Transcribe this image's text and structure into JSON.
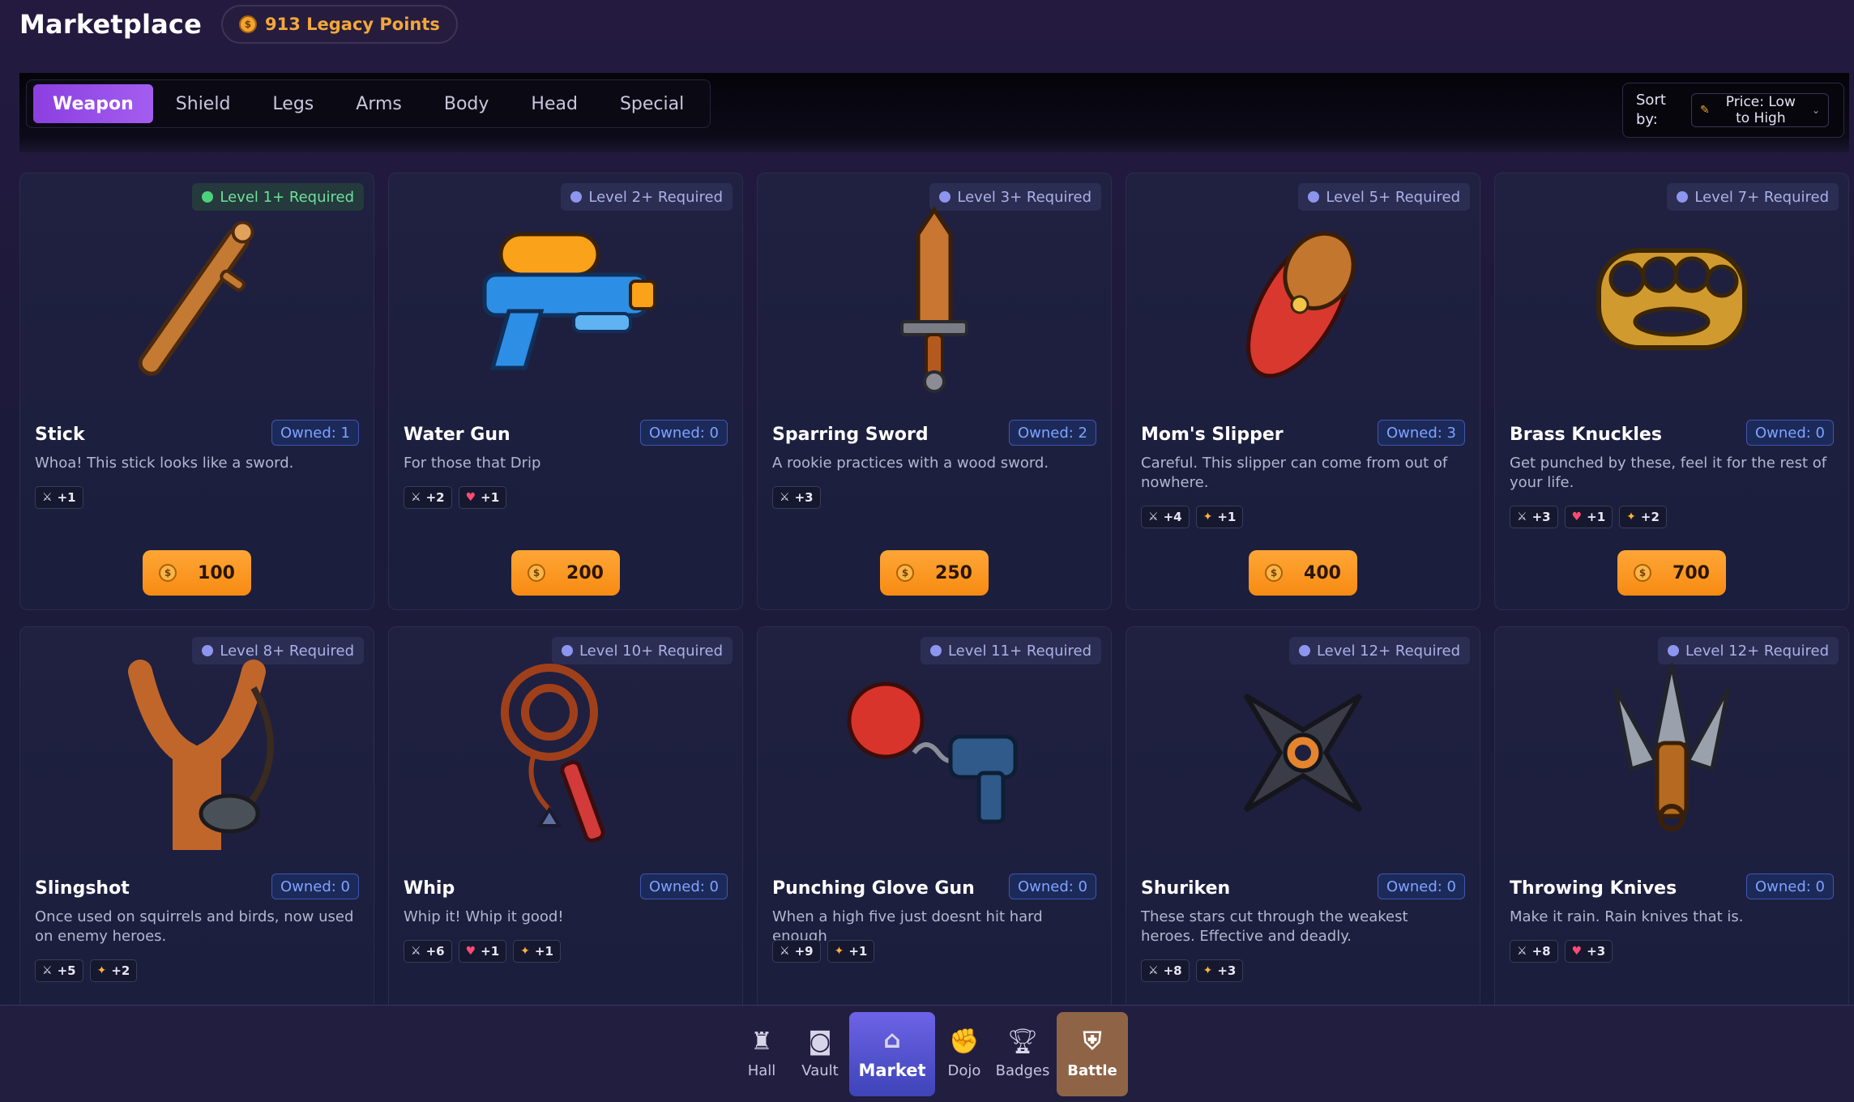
{
  "header": {
    "title": "Marketplace",
    "points": "913 Legacy Points"
  },
  "tabs": [
    {
      "label": "Weapon",
      "active": true
    },
    {
      "label": "Shield"
    },
    {
      "label": "Legs"
    },
    {
      "label": "Arms"
    },
    {
      "label": "Body"
    },
    {
      "label": "Head"
    },
    {
      "label": "Special"
    }
  ],
  "sort": {
    "label": "Sort by:",
    "value": "Price: Low to High"
  },
  "items": [
    {
      "name": "Stick",
      "owned": "Owned: 1",
      "requirement": "Level 1+ Required",
      "requirement_met": true,
      "description": "Whoa! This stick looks like a sword.",
      "stats": [
        {
          "type": "attack",
          "value": "+1"
        }
      ],
      "price": "100",
      "icon": "stick-icon"
    },
    {
      "name": "Water Gun",
      "owned": "Owned: 0",
      "requirement": "Level 2+ Required",
      "description": "For those that Drip",
      "stats": [
        {
          "type": "attack",
          "value": "+2"
        },
        {
          "type": "health",
          "value": "+1"
        }
      ],
      "price": "200",
      "icon": "water-gun-icon"
    },
    {
      "name": "Sparring Sword",
      "owned": "Owned: 2",
      "requirement": "Level 3+ Required",
      "description": "A rookie practices with a wood sword.",
      "stats": [
        {
          "type": "attack",
          "value": "+3"
        }
      ],
      "price": "250",
      "icon": "wooden-sword-icon"
    },
    {
      "name": "Mom's Slipper",
      "owned": "Owned: 3",
      "requirement": "Level 5+ Required",
      "description": "Careful. This slipper can come from out of nowhere.",
      "stats": [
        {
          "type": "attack",
          "value": "+4"
        },
        {
          "type": "speed",
          "value": "+1"
        }
      ],
      "price": "400",
      "icon": "slipper-icon"
    },
    {
      "name": "Brass Knuckles",
      "owned": "Owned: 0",
      "requirement": "Level 7+ Required",
      "description": "Get punched by these, feel it for the rest of your life.",
      "stats": [
        {
          "type": "attack",
          "value": "+3"
        },
        {
          "type": "health",
          "value": "+1"
        },
        {
          "type": "speed",
          "value": "+2"
        }
      ],
      "price": "700",
      "icon": "brass-knuckles-icon"
    },
    {
      "name": "Slingshot",
      "owned": "Owned: 0",
      "requirement": "Level 8+ Required",
      "description": "Once used on squirrels and birds, now used on enemy heroes.",
      "stats": [
        {
          "type": "attack",
          "value": "+5"
        },
        {
          "type": "speed",
          "value": "+2"
        }
      ],
      "icon": "slingshot-icon"
    },
    {
      "name": "Whip",
      "owned": "Owned: 0",
      "requirement": "Level 10+ Required",
      "description": "Whip it! Whip it good!",
      "stats": [
        {
          "type": "attack",
          "value": "+6"
        },
        {
          "type": "health",
          "value": "+1"
        },
        {
          "type": "speed",
          "value": "+1"
        }
      ],
      "icon": "whip-icon"
    },
    {
      "name": "Punching Glove Gun",
      "owned": "Owned: 0",
      "requirement": "Level 11+ Required",
      "description": "When a high five just doesnt hit hard enough",
      "stats": [
        {
          "type": "attack",
          "value": "+9"
        },
        {
          "type": "speed",
          "value": "+1"
        }
      ],
      "icon": "glove-gun-icon"
    },
    {
      "name": "Shuriken",
      "owned": "Owned: 0",
      "requirement": "Level 12+ Required",
      "description": "These stars cut through the weakest heroes. Effective and deadly.",
      "stats": [
        {
          "type": "attack",
          "value": "+8"
        },
        {
          "type": "speed",
          "value": "+3"
        }
      ],
      "icon": "shuriken-icon"
    },
    {
      "name": "Throwing Knives",
      "owned": "Owned: 0",
      "requirement": "Level 12+ Required",
      "description": "Make it rain. Rain knives that is.",
      "stats": [
        {
          "type": "attack",
          "value": "+8"
        },
        {
          "type": "health",
          "value": "+3"
        }
      ],
      "icon": "throwing-knives-icon"
    }
  ],
  "nav": [
    {
      "label": "Hall",
      "icon": "castle-icon"
    },
    {
      "label": "Vault",
      "icon": "vault-icon"
    },
    {
      "label": "Market",
      "icon": "store-icon",
      "active": true
    },
    {
      "label": "Dojo",
      "icon": "fist-icon"
    },
    {
      "label": "Badges",
      "icon": "trophy-icon"
    },
    {
      "label": "Battle",
      "icon": "shield-icon",
      "battle": true
    }
  ],
  "colors": {
    "accent": "#a45df0",
    "price": "#f78b12",
    "owned": "#7fa2ff",
    "requirement_met": "#4cd07c",
    "battle": "#8f6446"
  }
}
